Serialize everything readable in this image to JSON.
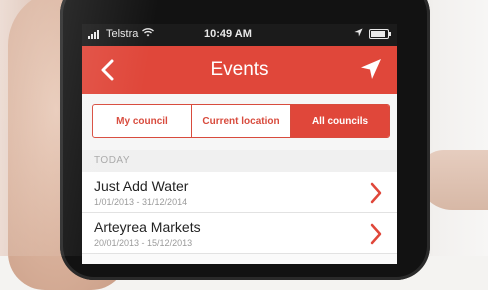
{
  "status_bar": {
    "carrier": "Telstra",
    "time": "10:49 AM",
    "battery_level": 0.85
  },
  "nav": {
    "title": "Events",
    "back_icon": "chevron-left-icon",
    "action_icon": "location-arrow-icon"
  },
  "segments": [
    {
      "label": "My council",
      "active": false
    },
    {
      "label": "Current location",
      "active": false
    },
    {
      "label": "All councils",
      "active": true
    }
  ],
  "section": {
    "header": "TODAY"
  },
  "events": [
    {
      "name": "Just Add Water",
      "dates": "1/01/2013 - 31/12/2014"
    },
    {
      "name": "Arteyrea Markets",
      "dates": "20/01/2013 - 15/12/2013"
    }
  ],
  "colors": {
    "accent": "#e0473a",
    "segment_border": "#d84b3d"
  }
}
